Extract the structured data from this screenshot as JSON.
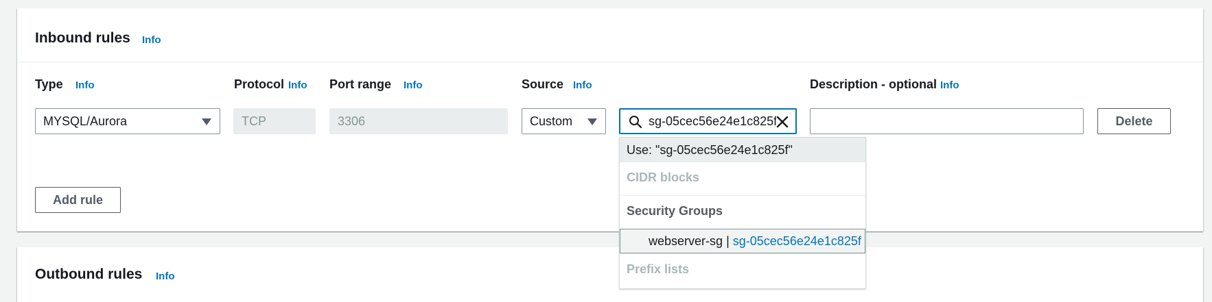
{
  "inbound": {
    "title": "Inbound rules",
    "info": "Info",
    "columns": {
      "type": "Type",
      "protocol": "Protocol",
      "port_range": "Port range",
      "source": "Source",
      "description": "Description - optional"
    },
    "column_info": "Info",
    "row": {
      "type_value": "MYSQL/Aurora",
      "protocol_value": "TCP",
      "port_range_value": "3306",
      "source_type": "Custom",
      "source_search_value": "sg-05cec56e24e1c825f",
      "description_value": "",
      "delete_label": "Delete"
    },
    "add_rule_label": "Add rule"
  },
  "source_dropdown": {
    "use_option": "Use: \"sg-05cec56e24e1c825f\"",
    "groups": {
      "cidr": "CIDR blocks",
      "security_groups": "Security Groups",
      "prefix_lists": "Prefix lists"
    },
    "security_group_option": {
      "name": "webserver-sg",
      "separator": "|",
      "id": "sg-05cec56e24e1c825f"
    }
  },
  "outbound": {
    "title": "Outbound rules",
    "info": "Info"
  },
  "colors": {
    "link": "#0073bb",
    "focus_border": "#0073bb",
    "disabled_text": "#879596",
    "page_bg": "#f2f3f3"
  },
  "icons": {
    "type_caret": "caret-down-icon",
    "source_caret": "caret-down-icon",
    "search": "search-icon",
    "clear": "close-icon"
  }
}
